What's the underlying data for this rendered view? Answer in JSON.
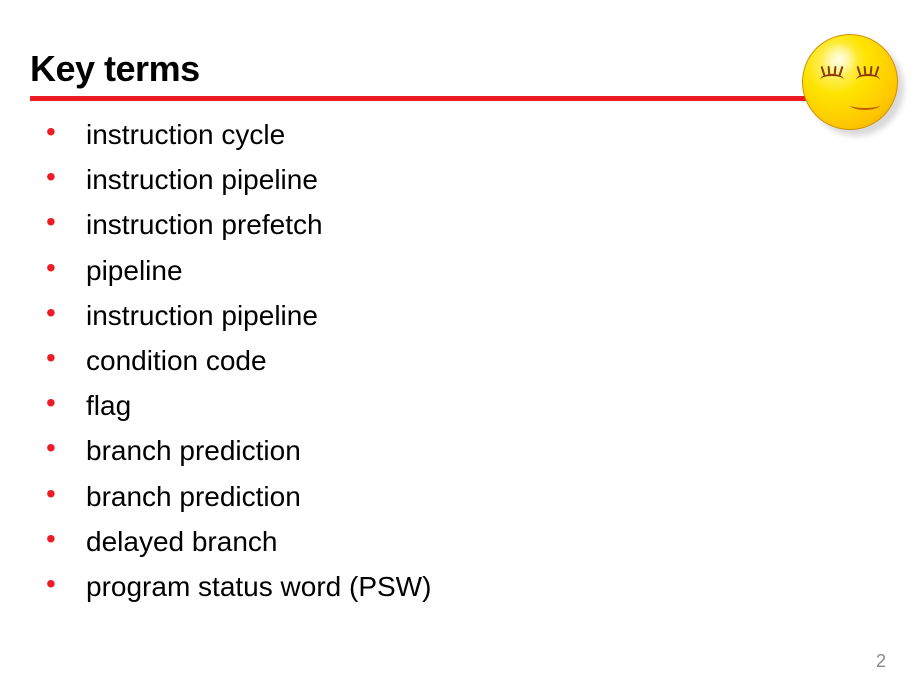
{
  "title": "Key terms",
  "bullets": [
    "instruction cycle",
    "instruction pipeline",
    "instruction prefetch",
    "pipeline",
    "instruction pipeline",
    "condition code",
    "flag",
    "branch prediction",
    "branch prediction",
    "delayed branch",
    "program status word (PSW)"
  ],
  "page_number": "2",
  "colors": {
    "accent": "#ed1c24"
  }
}
